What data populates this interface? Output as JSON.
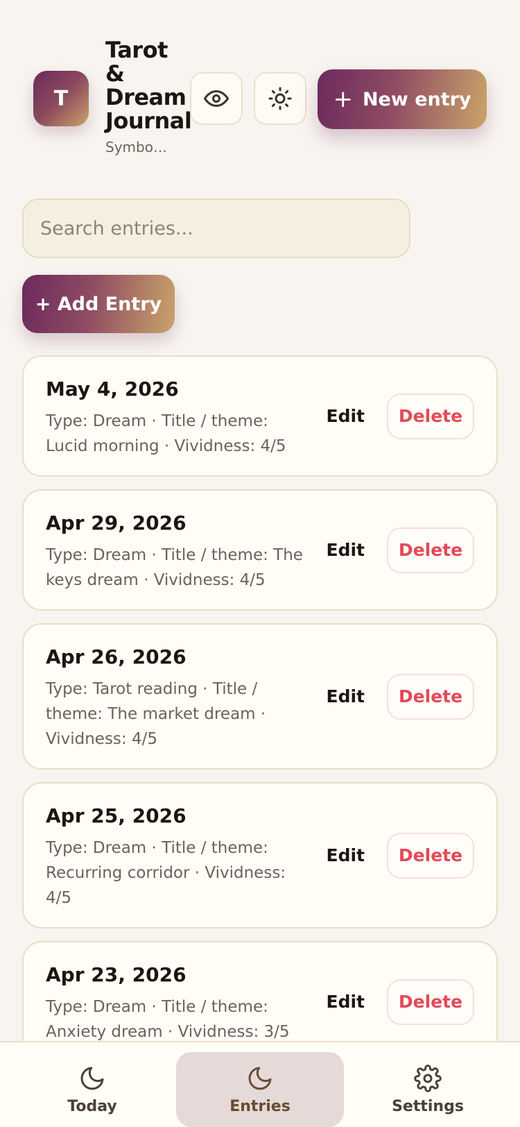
{
  "header": {
    "logo_letter": "T",
    "title": "Tarot & Dream Journal",
    "subtitle": "Symbo…",
    "new_entry_label": "New entry",
    "new_entry_plus": "+"
  },
  "search": {
    "placeholder": "Search entries..."
  },
  "add_entry_label": "+ Add Entry",
  "entries": [
    {
      "date": "May 4, 2026",
      "meta": "Type: Dream · Title / theme: Lucid morning · Vividness: 4/5",
      "edit": "Edit",
      "delete": "Delete"
    },
    {
      "date": "Apr 29, 2026",
      "meta": "Type: Dream · Title / theme: The keys dream · Vividness: 4/5",
      "edit": "Edit",
      "delete": "Delete"
    },
    {
      "date": "Apr 26, 2026",
      "meta": "Type: Tarot reading · Title / theme: The market dream · Vividness: 4/5",
      "edit": "Edit",
      "delete": "Delete"
    },
    {
      "date": "Apr 25, 2026",
      "meta": "Type: Dream · Title / theme: Recurring corridor · Vividness: 4/5",
      "edit": "Edit",
      "delete": "Delete"
    },
    {
      "date": "Apr 23, 2026",
      "meta": "Type: Dream · Title / theme: Anxiety dream · Vividness: 3/5",
      "edit": "Edit",
      "delete": "Delete"
    }
  ],
  "nav": {
    "items": [
      {
        "label": "Today",
        "icon": "moon-icon"
      },
      {
        "label": "Entries",
        "icon": "moon-icon",
        "active": true
      },
      {
        "label": "Settings",
        "icon": "gear-icon"
      }
    ]
  },
  "colors": {
    "accent_start": "#6b2a5c",
    "accent_end": "#c9a46a",
    "delete": "#e34a57",
    "background": "#f8f5f0"
  }
}
